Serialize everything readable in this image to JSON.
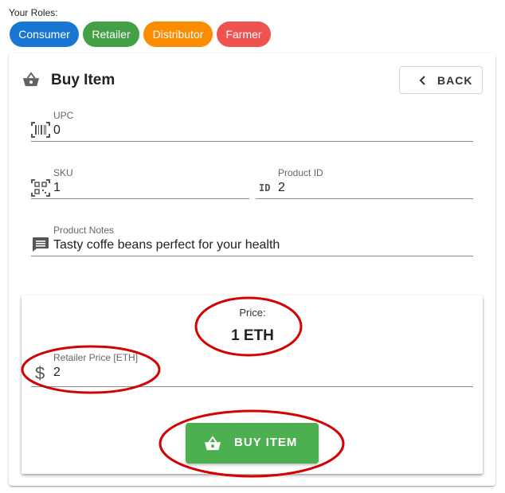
{
  "roles": {
    "label": "Your Roles:",
    "chips": [
      {
        "label": "Consumer",
        "color": "#1976d2"
      },
      {
        "label": "Retailer",
        "color": "#43a047"
      },
      {
        "label": "Distributor",
        "color": "#fb8c00"
      },
      {
        "label": "Farmer",
        "color": "#ef5350"
      }
    ]
  },
  "card": {
    "title": "Buy Item",
    "title_icon": "basket-icon",
    "back_label": "BACK"
  },
  "fields": {
    "upc": {
      "label": "UPC",
      "value": "0",
      "icon": "barcode-icon"
    },
    "sku": {
      "label": "SKU",
      "value": "1",
      "icon": "qr-code-icon"
    },
    "product_id": {
      "label": "Product ID",
      "value": "2",
      "icon": "id-icon"
    },
    "product_notes": {
      "label": "Product Notes",
      "value": "Tasty coffe beans perfect for your health",
      "icon": "comment-icon"
    }
  },
  "price": {
    "label": "Price:",
    "value": "1 ETH",
    "retailer_price_label": "Retailer Price [ETH]",
    "retailer_price_value": "2",
    "currency_icon": "dollar-icon"
  },
  "buy_button": {
    "label": "BUY ITEM",
    "icon": "basket-icon",
    "color": "#4caf50"
  },
  "annotation_color": "#d50000"
}
